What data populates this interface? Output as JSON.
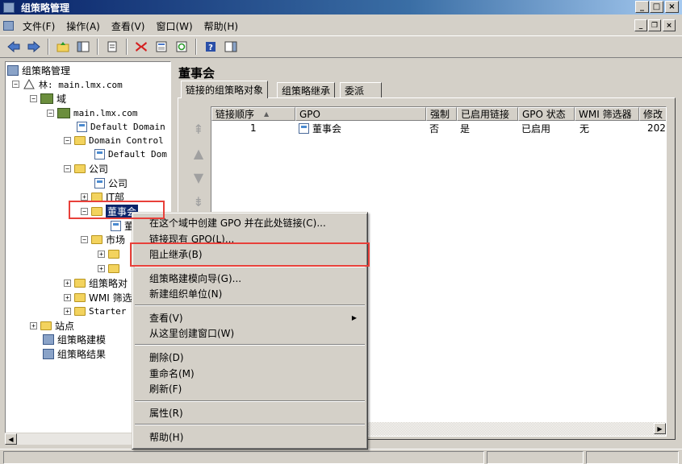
{
  "window": {
    "title": "组策略管理",
    "controls": {
      "minimize": "_",
      "maximize": "□",
      "close": "×"
    },
    "mdi_controls": {
      "minimize": "_",
      "restore": "❐",
      "close": "×"
    }
  },
  "menubar": {
    "items": [
      {
        "label": "文件(F)"
      },
      {
        "label": "操作(A)"
      },
      {
        "label": "查看(V)"
      },
      {
        "label": "窗口(W)"
      },
      {
        "label": "帮助(H)"
      }
    ]
  },
  "tree": {
    "root": "组策略管理",
    "forest": "林: main.lmx.com",
    "domains": "域",
    "domain": "main.lmx.com",
    "default_domain_policy": "Default Domain",
    "domain_controllers": "Domain Control",
    "default_dc_policy": "Default Dom",
    "company_ou": "公司",
    "company_gpo": "公司",
    "it_ou": "IT部",
    "board_ou": "董事会",
    "board_gpo": "董",
    "market_ou": "市场",
    "sub1": "",
    "sub2": "",
    "gpo_objects": "组策略对",
    "wmi_filters": "WMI 筛选",
    "starter": "Starter",
    "sites": "站点",
    "modeling": "组策略建模",
    "results": "组策略结果"
  },
  "right": {
    "title": "董事会",
    "tabs": [
      {
        "label": "链接的组策略对象"
      },
      {
        "label": "组策略继承"
      },
      {
        "label": "委派"
      }
    ],
    "columns": [
      "链接顺序",
      "GPO",
      "强制",
      "已启用链接",
      "GPO 状态",
      "WMI 筛选器",
      "修改"
    ],
    "rows": [
      {
        "order": "1",
        "gpo": "董事会",
        "enforced": "否",
        "link_enabled": "是",
        "status": "已启用",
        "wmi": "无",
        "modified": "202"
      }
    ],
    "sort_indicator": "▲"
  },
  "context_menu": {
    "items": [
      {
        "label": "在这个域中创建 GPO 并在此处链接(C)..."
      },
      {
        "label": "链接现有 GPO(L)..."
      },
      {
        "label": "阻止继承(B)"
      },
      {
        "label": "组策略建模向导(G)..."
      },
      {
        "label": "新建组织单位(N)"
      },
      {
        "label": "查看(V)"
      },
      {
        "label": "从这里创建窗口(W)"
      },
      {
        "label": "删除(D)"
      },
      {
        "label": "重命名(M)"
      },
      {
        "label": "刷新(F)"
      },
      {
        "label": "属性(R)"
      },
      {
        "label": "帮助(H)"
      }
    ],
    "submenu_arrow": "▶"
  },
  "colors": {
    "highlight": "#e8403a",
    "selection": "#0a246a",
    "titlebar": "#0a246a"
  }
}
